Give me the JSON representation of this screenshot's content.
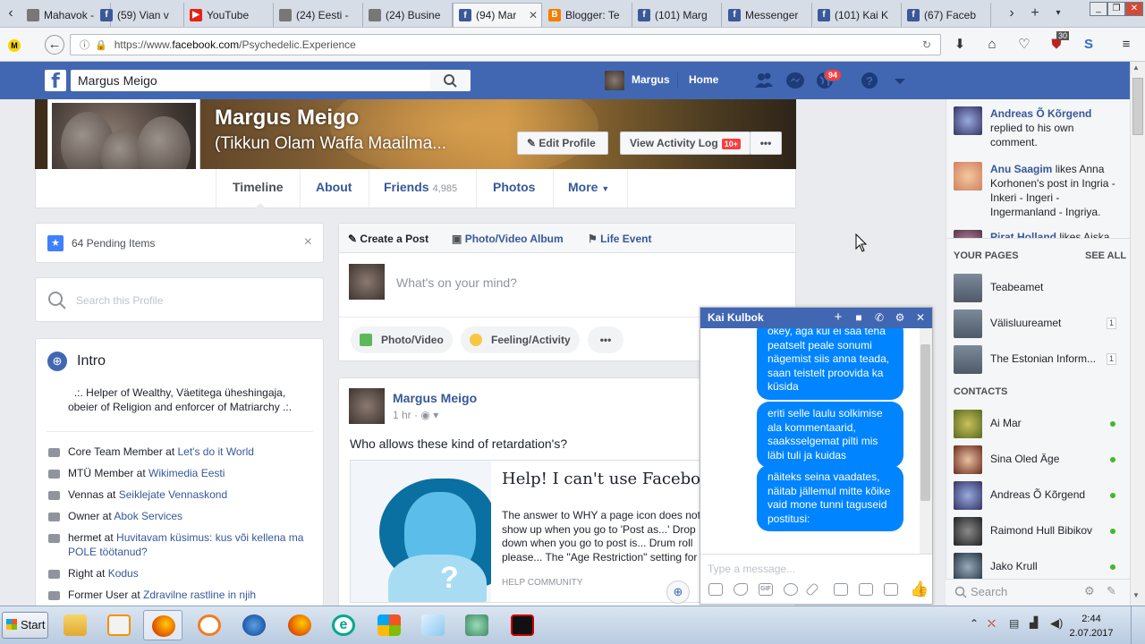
{
  "browser": {
    "tabs": [
      {
        "title": "Mahavok -",
        "favicon": "page-icon",
        "color": "#777"
      },
      {
        "title": "(59) Vian v",
        "favicon": "facebook-icon",
        "color": "#3b5998"
      },
      {
        "title": "YouTube",
        "favicon": "youtube-icon",
        "color": "#e62117"
      },
      {
        "title": "(24) Eesti -",
        "favicon": "page-icon",
        "color": "#777"
      },
      {
        "title": "(24) Busine",
        "favicon": "page-icon",
        "color": "#777"
      },
      {
        "title": "(94) Mar",
        "favicon": "facebook-icon",
        "color": "#3b5998",
        "active": true
      },
      {
        "title": "Blogger: Te",
        "favicon": "blogger-icon",
        "color": "#f57d00"
      },
      {
        "title": "(101) Marg",
        "favicon": "facebook-icon",
        "color": "#3b5998"
      },
      {
        "title": "Messenger",
        "favicon": "facebook-icon",
        "color": "#3b5998"
      },
      {
        "title": "(101) Kai K",
        "favicon": "facebook-icon",
        "color": "#3b5998"
      },
      {
        "title": "(67) Faceb",
        "favicon": "facebook-icon",
        "color": "#3b5998"
      }
    ],
    "url_prefix": "https://www.",
    "url_domain": "facebook.com",
    "url_path": "/Psychedelic.Experience",
    "extension_badge": "30"
  },
  "fb": {
    "search_value": "Margus Meigo",
    "user_name": "Margus",
    "home_label": "Home",
    "notif_count": "94"
  },
  "profile": {
    "name": "Margus Meigo",
    "subtitle": "(Tikkun Olam Waffa Maailma...",
    "edit_profile": "Edit Profile",
    "activity_log": "View Activity Log",
    "activity_badge": "10+",
    "tabs": {
      "timeline": "Timeline",
      "about": "About",
      "friends": "Friends",
      "friends_count": "4,985",
      "photos": "Photos",
      "more": "More"
    }
  },
  "left": {
    "pending": "64 Pending Items",
    "search_placeholder": "Search this Profile",
    "intro_title": "Intro",
    "intro_bio": ".:. Helper of Wealthy, Väetitega üheshingaja, obeier of Religion and enforcer of Matriarchy .:.",
    "items": [
      {
        "pre": "Core Team Member at ",
        "link": "Let's do it World"
      },
      {
        "pre": "MTÜ Member at ",
        "link": "Wikimedia Eesti"
      },
      {
        "pre": "Vennas at ",
        "link": "Seiklejate Vennaskond"
      },
      {
        "pre": "Owner at ",
        "link": "Abok Services"
      },
      {
        "pre": "hermet at ",
        "link": "Huvitavam küsimus: kus või kellena ma POLE töötanud?"
      },
      {
        "pre": "Right at ",
        "link": "Kodus"
      },
      {
        "pre": "Former User at ",
        "link": "Zdravilne rastline in njih"
      }
    ]
  },
  "composer": {
    "create_post": "Create a Post",
    "album": "Photo/Video Album",
    "life_event": "Life Event",
    "placeholder": "What's on your mind?",
    "photo_video": "Photo/Video",
    "feeling": "Feeling/Activity"
  },
  "post": {
    "author": "Margus Meigo",
    "time": "1 hr",
    "text": "Who allows these kind of retardation's?",
    "link_title": "Help! I can't use Facebook anymore.",
    "link_desc": "The answer to WHY a page icon does not show up when you go to 'Post as...' Drop down when you go to post is... Drum roll please... The \"Age Restriction\" setting for your own page. My Conservative...",
    "link_source": "HELP COMMUNITY"
  },
  "chat": {
    "name": "Kai Kulbok",
    "messages": [
      "okey, aga kui ei saa teha peatselt peale sonumi nägemist siis anna teada, saan teistelt proovida ka küsida",
      "eriti selle laulu solkimise ala kommentaarid, saaksselgemat pilti mis läbi tuli ja kuidas",
      "näiteks seina vaadates, näitab jällemul mitte kõike vaid mone tunni taguseid postitusi:"
    ],
    "input_placeholder": "Type a message..."
  },
  "sidebar": {
    "ticker": [
      {
        "name": "Andreas Õ Kõrgend",
        "text": " replied to his own comment."
      },
      {
        "name": "Anu Saagim",
        "text": " likes Anna Korhonen's post in Ingria - Inkeri - Ingeri - Ingermanland - Ingriya."
      },
      {
        "name": "Pirat Holland",
        "text": " likes Aiska"
      }
    ],
    "your_pages": "YOUR PAGES",
    "see_all": "SEE ALL",
    "pages": [
      {
        "name": "Teabeamet",
        "count": ""
      },
      {
        "name": "Välisluureamet",
        "count": "1"
      },
      {
        "name": "The Estonian Inform...",
        "count": "1"
      }
    ],
    "contacts_title": "CONTACTS",
    "contacts": [
      {
        "name": "Ai Mar"
      },
      {
        "name": "Sina Oled Äge"
      },
      {
        "name": "Andreas Õ Kõrgend"
      },
      {
        "name": "Raimond Hull Bibikov"
      },
      {
        "name": "Jako Krull"
      }
    ],
    "search_placeholder": "Search"
  },
  "taskbar": {
    "start": "Start",
    "time": "2:44",
    "date": "2.07.2017"
  }
}
